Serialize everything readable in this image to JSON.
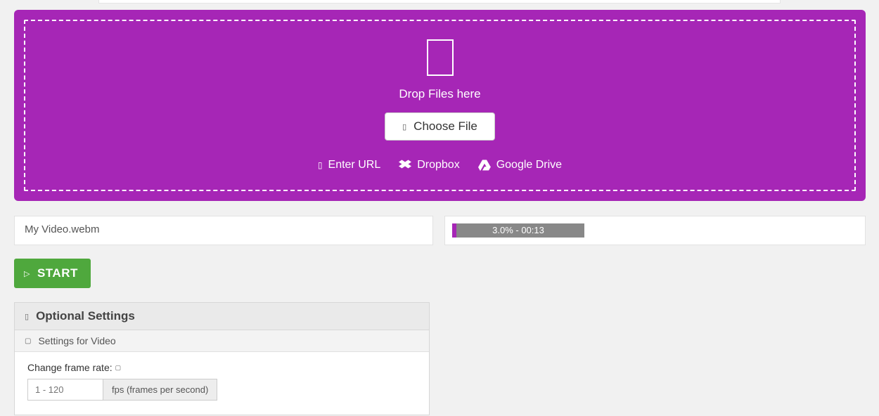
{
  "dropzone": {
    "drop_label": "Drop Files here",
    "choose_label": "Choose File",
    "sources": {
      "url": "Enter URL",
      "dropbox": "Dropbox",
      "drive": "Google Drive"
    }
  },
  "file": {
    "name": "My Video.webm",
    "progress_text": "3.0% - 00:13",
    "progress_percent": 3.0
  },
  "start_label": "START",
  "settings": {
    "title": "Optional Settings",
    "video_header": "Settings for Video",
    "frame_rate_label": "Change frame rate:",
    "frame_rate_placeholder": "1 - 120",
    "fps_addon": "fps (frames per second)"
  }
}
